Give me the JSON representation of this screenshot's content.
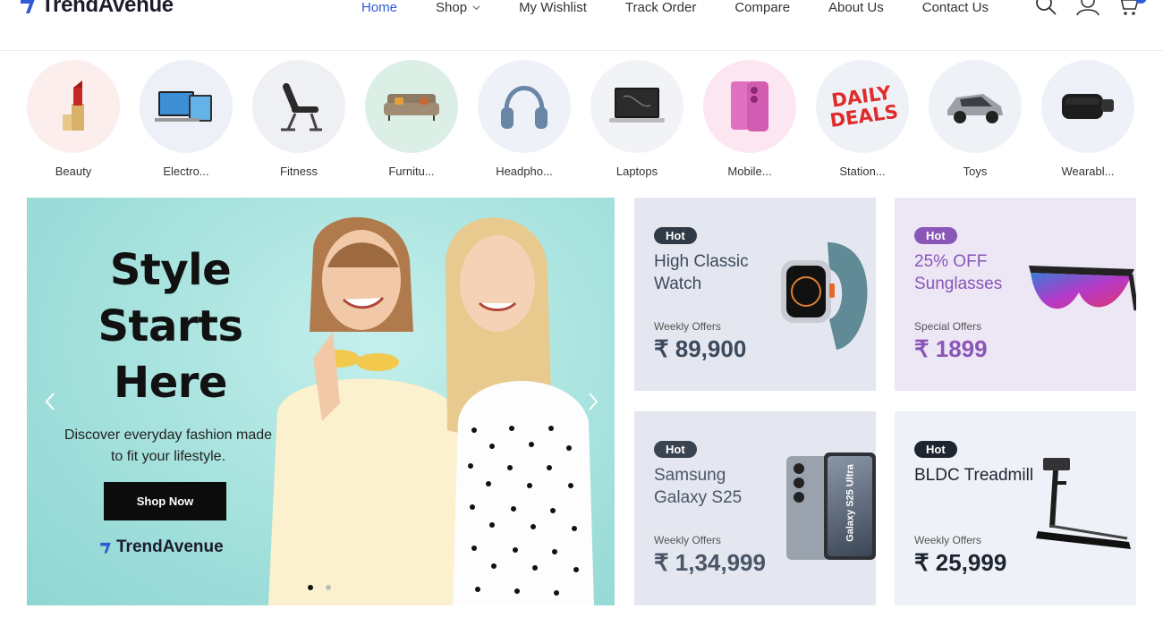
{
  "brand": {
    "name": "TrendAvenue",
    "color": "#1c1c2e",
    "logo_accent": "#2f5bd4"
  },
  "nav": {
    "items": [
      {
        "label": "Home",
        "active": true
      },
      {
        "label": "Shop",
        "has_dropdown": true
      },
      {
        "label": "My Wishlist"
      },
      {
        "label": "Track Order"
      },
      {
        "label": "Compare"
      },
      {
        "label": "About Us"
      },
      {
        "label": "Contact Us"
      }
    ],
    "active_color": "#2f5bd4",
    "icons": [
      "search-icon",
      "user-icon",
      "cart-icon"
    ]
  },
  "categories": [
    {
      "label": "Beauty",
      "bg": "#fdeeee",
      "icon": "lipstick-icon"
    },
    {
      "label": "Electro...",
      "bg": "#edf1f7",
      "icon": "devices-icon"
    },
    {
      "label": "Fitness",
      "bg": "#eef0f4",
      "icon": "bench-icon"
    },
    {
      "label": "Furnitu...",
      "bg": "#dcefe6",
      "icon": "sofa-icon"
    },
    {
      "label": "Headpho...",
      "bg": "#eef2f8",
      "icon": "headphones-icon"
    },
    {
      "label": "Laptops",
      "bg": "#f1f3f7",
      "icon": "laptop-icon"
    },
    {
      "label": "Mobile...",
      "bg": "#fbe6f1",
      "icon": "phone-icon"
    },
    {
      "label": "Station...",
      "bg": "#eef1f6",
      "icon": "daily-deals-icon",
      "image_text": [
        "DAILY",
        "DEALS"
      ]
    },
    {
      "label": "Toys",
      "bg": "#eef1f6",
      "icon": "toy-car-icon"
    },
    {
      "label": "Wearabl...",
      "bg": "#eef1f7",
      "icon": "vr-headset-icon"
    }
  ],
  "hero": {
    "title_lines": [
      "Style",
      "Starts",
      "Here"
    ],
    "subtitle": "Discover everyday fashion made to fit your lifestyle.",
    "button_label": "Shop Now",
    "brand_label": "TrendAvenue",
    "slide_count": 2,
    "active_slide": 1,
    "bg_color": "#a6e3e0"
  },
  "promos": [
    {
      "badge": "Hot",
      "title": "High Classic Watch",
      "kicker": "Weekly Offers",
      "price": "₹ 89,900",
      "bg": "#e4e7ef",
      "accent": "#3d4a5c",
      "badge_bg": "#2f3a46",
      "image": "watch-icon"
    },
    {
      "badge": "Hot",
      "title": "25% OFF Sunglasses",
      "kicker": "Special Offers",
      "price": "₹ 1899",
      "bg": "#ece6f5",
      "accent": "#8a56b8",
      "badge_bg": "#8a56b8",
      "image": "sunglasses-icon"
    },
    {
      "badge": "Hot",
      "title": "Samsung Galaxy S25",
      "kicker": "Weekly Offers",
      "price": "₹ 1,34,999",
      "bg": "#e4e7ef",
      "accent": "#4a5568",
      "badge_bg": "#3a4350",
      "image": "smartphone-icon",
      "image_text": "Galaxy S25 Ultra"
    },
    {
      "badge": "Hot",
      "title": "BLDC Treadmill",
      "kicker": "Weekly Offers",
      "price": "₹ 25,999",
      "bg": "#eef1f7",
      "accent": "#1e2530",
      "badge_bg": "#1e2530",
      "image": "treadmill-icon"
    }
  ]
}
